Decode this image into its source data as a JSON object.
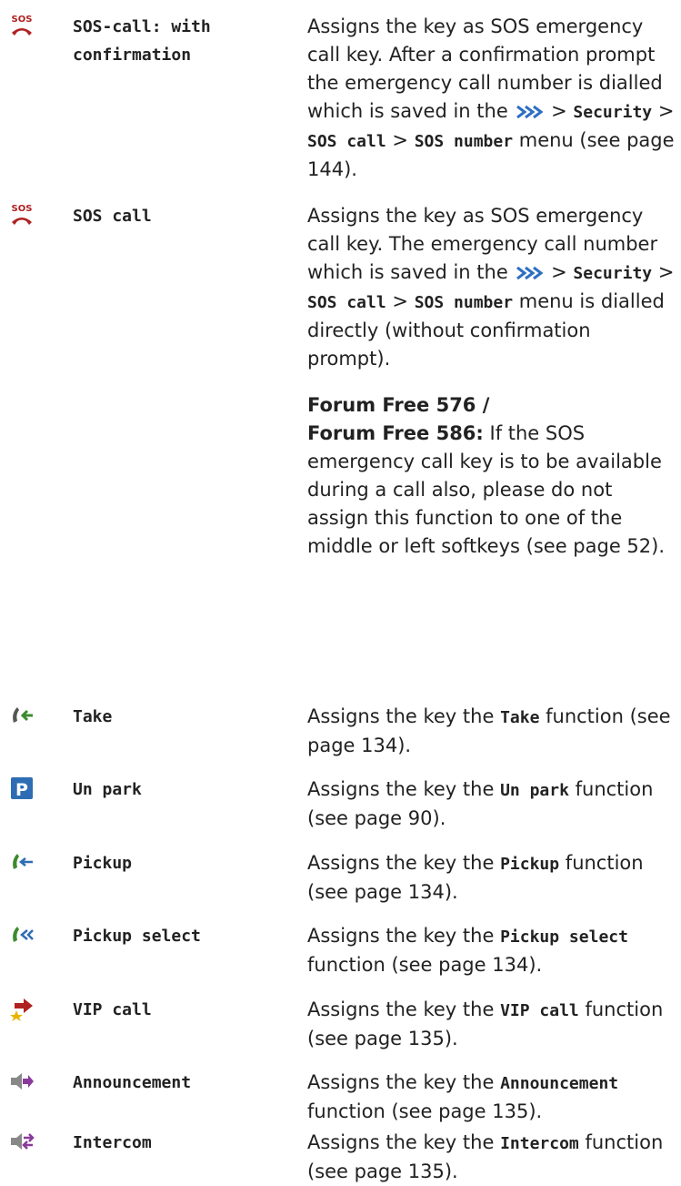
{
  "rows": [
    {
      "icon": "sos-call-with-confirmation-icon",
      "name": "SOS-call: with confirmation",
      "desc": {
        "p1": "Assigns the key as SOS emergency call key. After a confirmation prompt the emergency call number is dialled which is saved in the",
        "sep1": ">",
        "m1": "Security",
        "sep2": ">",
        "m2": "SOS call",
        "sep3": ">",
        "m3": "SOS number",
        "p2": "menu (see page 144)."
      }
    },
    {
      "icon": "sos-call-icon",
      "name": "SOS call",
      "desc": {
        "p1": "Assigns the key as SOS emergency call key. The emergency call number which is saved in the",
        "sep1": ">",
        "m1": "Security",
        "sep2": ">",
        "m2": "SOS call",
        "sep3": ">",
        "m3": "SOS number",
        "p2": "menu is dialled directly (without confirmation prompt).",
        "note_bold1": "Forum Free 576 /",
        "note_bold2": "Forum Free 586:",
        "note_text": "If the SOS emergency call key is to be available during a call also, please do not assign this function to one of the middle or left softkeys (see page 52)."
      }
    },
    {
      "icon": "take-icon",
      "name": "Take",
      "pre": "Assigns the key the",
      "fn": "Take",
      "post": "function (see page 134)."
    },
    {
      "icon": "unpark-icon",
      "name": "Un park",
      "pre": "Assigns the key the",
      "fn": "Un park",
      "post": "function (see page 90)."
    },
    {
      "icon": "pickup-icon",
      "name": "Pickup",
      "pre": "Assigns the key the",
      "fn": "Pickup",
      "post": "function (see page 134)."
    },
    {
      "icon": "pickup-select-icon",
      "name": "Pickup select",
      "pre": "Assigns the key the",
      "fn": "Pickup select",
      "post": "function (see page 134)."
    },
    {
      "icon": "vip-call-icon",
      "name": "VIP call",
      "pre": "Assigns the key the",
      "fn": "VIP call",
      "post": "function (see page 135)."
    },
    {
      "icon": "announcement-icon",
      "name": "Announcement",
      "pre": "Assigns the key the",
      "fn": "Announcement",
      "post": "function (see page 135)."
    },
    {
      "icon": "intercom-icon",
      "name": "Intercom",
      "pre": "Assigns the key the",
      "fn": "Intercom",
      "post": "function (see page 135)."
    }
  ],
  "colors": {
    "sos_red": "#b02020",
    "unpark_blue": "#2e6db4",
    "green": "#3d8a2e",
    "purple": "#8a3a9a",
    "menu_chevron": "#2d6fc4"
  }
}
